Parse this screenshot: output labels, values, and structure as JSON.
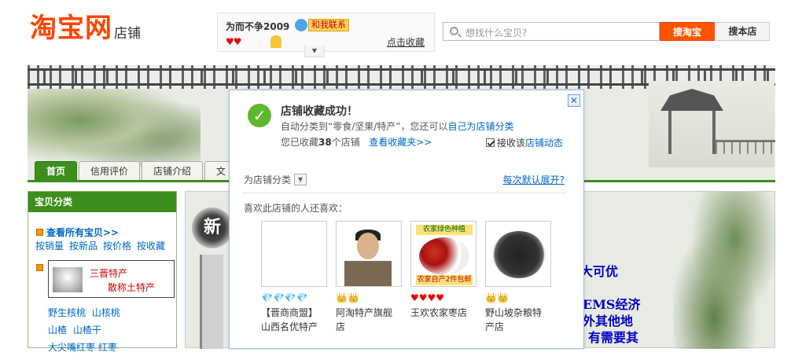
{
  "logo": {
    "main": "淘宝网",
    "sub": "店铺"
  },
  "shop": {
    "name": "为而不争2009",
    "contact": "和我联系",
    "rating_hearts": "♥♥",
    "favorite_link": "点击收藏"
  },
  "search": {
    "placeholder": "想找什么宝贝?",
    "btn_taobao": "搜淘宝",
    "btn_shop": "搜本店"
  },
  "nav": {
    "tabs": [
      "首页",
      "信用评价",
      "店铺介绍",
      "文"
    ]
  },
  "sidebar": {
    "title": "宝贝分类",
    "all_items": "查看所有宝贝>>",
    "sorts": [
      "按销量",
      "按新品",
      "按价格",
      "按收藏"
    ],
    "cat_line1": "三晋特产",
    "cat_line2": "散称土特产",
    "sublinks_row1": [
      "野生核桃",
      "山核桃"
    ],
    "sublinks_row2": [
      "山楂",
      "山楂干"
    ],
    "sublinks_row3": [
      "大尖嘴红枣 红枣"
    ]
  },
  "main": {
    "ink_char": "新",
    "ad_lines": [
      "大可优",
      "EMS经济",
      "外其他地",
      "有需要其"
    ]
  },
  "popup": {
    "title": "店铺收藏成功！",
    "line2_prefix": "自动分类到“零食/坚果/特产”，您还可以",
    "line2_link": "自己为店铺分类",
    "line3_prefix": "您已收藏",
    "line3_count": "38",
    "line3_suffix": "个店铺",
    "line3_link": "查看收藏夹>>",
    "checkbox_prefix": "接收该",
    "checkbox_link": "店铺动态",
    "category_label": "为店铺分类",
    "expand_link": "每次默认展开?",
    "like_label": "喜欢此店铺的人还喜欢：",
    "items": [
      {
        "rating": "💎💎💎💎",
        "name_l1": "【晋商商盟】",
        "name_l2": "山西名优特产"
      },
      {
        "rating": "👑👑",
        "name_l1": "阿淘特产旗舰",
        "name_l2": "店"
      },
      {
        "rating": "♥♥♥♥",
        "name_l1": "王欢农家枣店",
        "name_l2": ""
      },
      {
        "rating": "👑👑",
        "name_l1": "野山坡杂粮特",
        "name_l2": "产店"
      }
    ],
    "thumb3_top": "农家绿色种植",
    "thumb3_bottom": "农家自产2件包邮"
  }
}
